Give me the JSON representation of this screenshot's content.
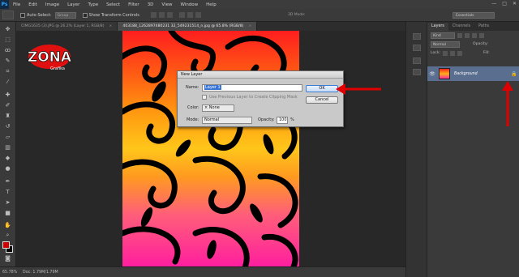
{
  "app": {
    "logo": "Ps",
    "menu": [
      "File",
      "Edit",
      "Image",
      "Layer",
      "Type",
      "Select",
      "Filter",
      "3D",
      "View",
      "Window",
      "Help"
    ],
    "window_controls": [
      "—",
      "□",
      "✕"
    ]
  },
  "options_bar": {
    "auto_select_label": "Auto-Select:",
    "auto_select_value": "Group",
    "transform_label": "Show Transform Controls",
    "mode_3d_label": "3D Mode:",
    "workspace_value": "Essentials"
  },
  "tabs": [
    {
      "label": "CIMG1635 (3).JPG @ 26.2% (Layer 1, RGB/8)",
      "close": "×"
    },
    {
      "label": "403188_1262897480231 32_549231514_n.jpg @ 65.8% (RGB/8)",
      "close": "×"
    }
  ],
  "watermark": {
    "brand": "ZONA",
    "subtitle": "Grafika"
  },
  "status_bar": {
    "zoom": "65.78%",
    "doc_info": "Doc: 1.79M/1.79M"
  },
  "layers_panel": {
    "tabs": [
      "Layers",
      "Channels",
      "Paths"
    ],
    "kind_label": "Kind",
    "blend_mode": "Normal",
    "opacity_label": "Opacity:",
    "lock_label": "Lock:",
    "fill_label": "Fill:",
    "layer": {
      "name": "Background",
      "eye": "👁",
      "lock": "🔒"
    }
  },
  "dialog": {
    "title": "New Layer",
    "name_label": "Name:",
    "name_value": "Layer 1",
    "clipping_label": "Use Previous Layer to Create Clipping Mask",
    "color_label": "Color:",
    "color_value": "× None",
    "mode_label": "Mode:",
    "mode_value": "Normal",
    "opacity_label": "Opacity:",
    "opacity_value": "100",
    "opacity_unit": "%",
    "ok_label": "OK",
    "cancel_label": "Cancel"
  },
  "colors": {
    "arrow": "#e00000",
    "foreground": "#cc0000",
    "background": "#000000",
    "selected_layer": "#5a6f8f"
  },
  "icons": [
    "move-icon",
    "marquee-icon",
    "lasso-icon",
    "quick-select-icon",
    "crop-icon",
    "eyedropper-icon",
    "healing-icon",
    "brush-icon",
    "clone-stamp-icon",
    "history-brush-icon",
    "eraser-icon",
    "gradient-icon",
    "blur-icon",
    "dodge-icon",
    "pen-icon",
    "type-icon",
    "path-select-icon",
    "shape-icon",
    "hand-icon",
    "zoom-icon"
  ]
}
